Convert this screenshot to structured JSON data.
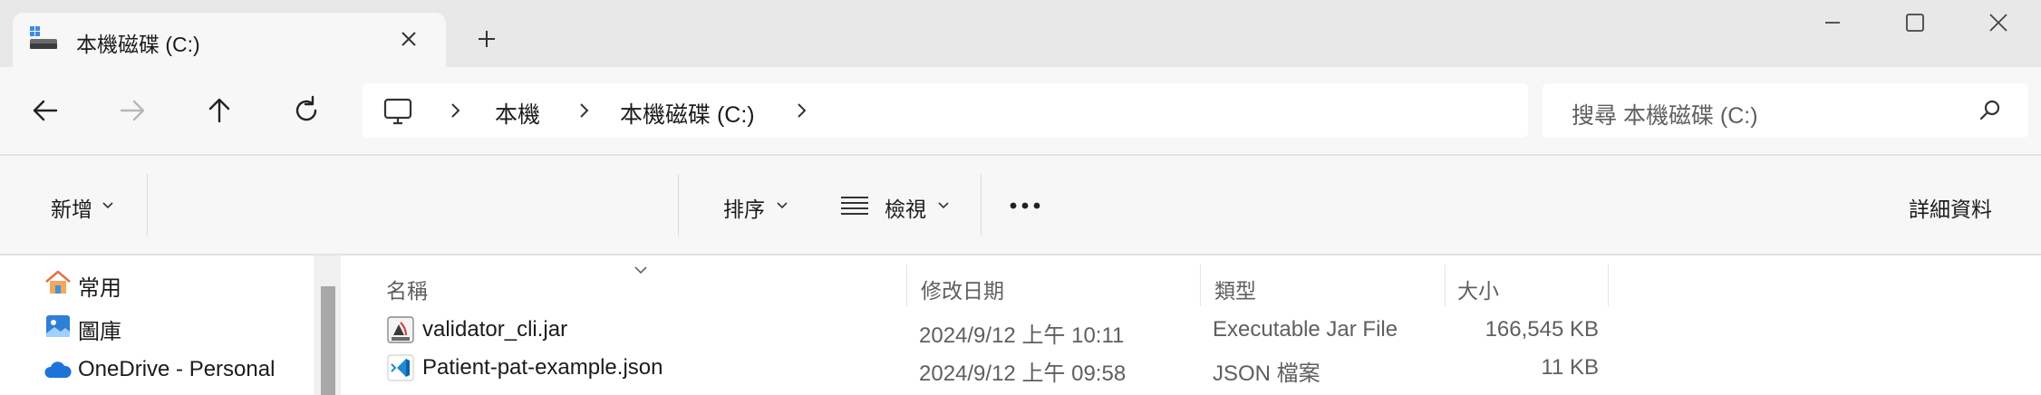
{
  "tab": {
    "title": "本機磁碟 (C:)"
  },
  "address": {
    "segments": [
      "本機",
      "本機磁碟 (C:)"
    ]
  },
  "search": {
    "placeholder": "搜尋 本機磁碟 (C:)"
  },
  "toolbar": {
    "new_label": "新增",
    "sort_label": "排序",
    "view_label": "檢視",
    "details_label": "詳細資料"
  },
  "sidebar": {
    "items": [
      {
        "label": "常用",
        "icon": "home-icon"
      },
      {
        "label": "圖庫",
        "icon": "gallery-icon"
      },
      {
        "label": "OneDrive - Personal",
        "icon": "onedrive-cloud-icon"
      }
    ]
  },
  "filelist": {
    "columns": [
      "名稱",
      "修改日期",
      "類型",
      "大小"
    ],
    "rows": [
      {
        "name": "validator_cli.jar",
        "date": "2024/9/12 上午 10:11",
        "type": "Executable Jar File",
        "size": "166,545 KB",
        "icon": "java-jar-icon"
      },
      {
        "name": "Patient-pat-example.json",
        "date": "2024/9/12 上午 09:58",
        "type": "JSON 檔案",
        "size": "11 KB",
        "icon": "vscode-json-icon"
      }
    ]
  },
  "colors": {
    "titlebar_bg": "#e8e8e8",
    "chrome_bg": "#f7f7f7",
    "accent_blue": "#0078d4"
  }
}
